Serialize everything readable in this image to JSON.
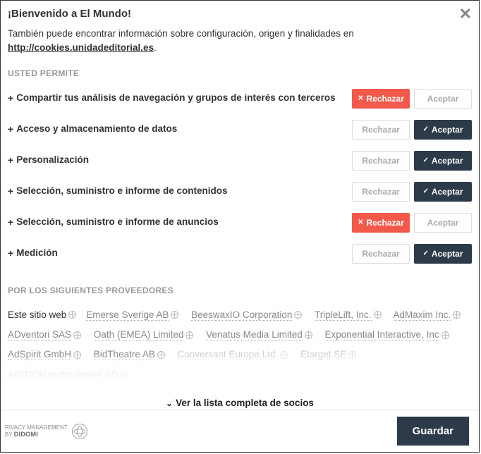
{
  "title": "¡Bienvenido a El Mundo!",
  "subtitle_pre": "También puede encontrar información sobre configuración, origen y finalidades en ",
  "subtitle_link": "http://cookies.unidadeditorial.es",
  "subtitle_post": ".",
  "permit_header": "USTED PERMITE",
  "reject_label": "Rechazar",
  "accept_label": "Aceptar",
  "purposes": [
    {
      "label": "Compartir tus análisis de navegación y grupos de interés con terceros",
      "selected": "reject"
    },
    {
      "label": "Acceso y almacenamiento de datos",
      "selected": "accept"
    },
    {
      "label": "Personalización",
      "selected": "accept"
    },
    {
      "label": "Selección, suministro e informe de contenidos",
      "selected": "accept"
    },
    {
      "label": "Selección, suministro e informe de anuncios",
      "selected": "reject"
    },
    {
      "label": "Medición",
      "selected": "accept"
    }
  ],
  "vendors_header": "POR LOS SIGUIENTES PROVEEDORES",
  "vendors_first": "Este sitio web",
  "vendors": [
    "Emerse Sverige AB",
    "BeeswaxIO Corporation",
    "TripleLift, Inc.",
    "AdMaxim Inc.",
    "ADventori SAS",
    "Oath (EMEA) Limited",
    "Venatus Media Limited",
    "Exponential Interactive, Inc",
    "AdSpirit GmbH",
    "BidTheatre AB",
    "Conversant Europe Ltd.",
    "Etarget SE",
    "ADITION technologies AG"
  ],
  "see_all": "Ver la lista completa de socios",
  "brand_line1": "rivacy Management",
  "brand_line2": "by",
  "brand_name": "DIDOMI",
  "save": "Guardar"
}
